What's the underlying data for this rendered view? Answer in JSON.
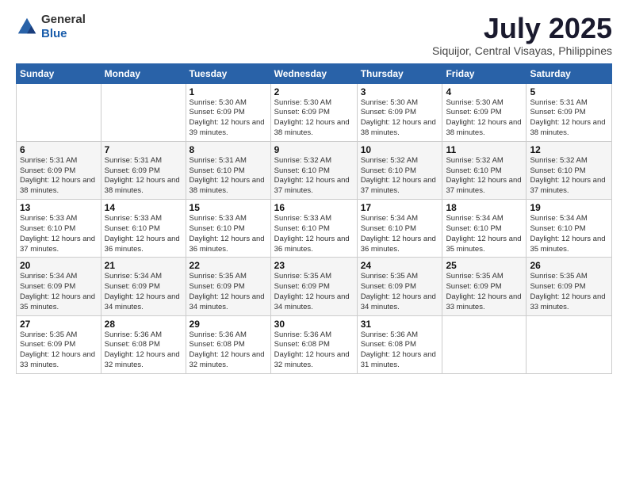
{
  "header": {
    "logo_general": "General",
    "logo_blue": "Blue",
    "month_year": "July 2025",
    "location": "Siquijor, Central Visayas, Philippines"
  },
  "days_of_week": [
    "Sunday",
    "Monday",
    "Tuesday",
    "Wednesday",
    "Thursday",
    "Friday",
    "Saturday"
  ],
  "weeks": [
    [
      {
        "day": "",
        "detail": ""
      },
      {
        "day": "",
        "detail": ""
      },
      {
        "day": "1",
        "detail": "Sunrise: 5:30 AM\nSunset: 6:09 PM\nDaylight: 12 hours and 39 minutes."
      },
      {
        "day": "2",
        "detail": "Sunrise: 5:30 AM\nSunset: 6:09 PM\nDaylight: 12 hours and 38 minutes."
      },
      {
        "day": "3",
        "detail": "Sunrise: 5:30 AM\nSunset: 6:09 PM\nDaylight: 12 hours and 38 minutes."
      },
      {
        "day": "4",
        "detail": "Sunrise: 5:30 AM\nSunset: 6:09 PM\nDaylight: 12 hours and 38 minutes."
      },
      {
        "day": "5",
        "detail": "Sunrise: 5:31 AM\nSunset: 6:09 PM\nDaylight: 12 hours and 38 minutes."
      }
    ],
    [
      {
        "day": "6",
        "detail": "Sunrise: 5:31 AM\nSunset: 6:09 PM\nDaylight: 12 hours and 38 minutes."
      },
      {
        "day": "7",
        "detail": "Sunrise: 5:31 AM\nSunset: 6:09 PM\nDaylight: 12 hours and 38 minutes."
      },
      {
        "day": "8",
        "detail": "Sunrise: 5:31 AM\nSunset: 6:10 PM\nDaylight: 12 hours and 38 minutes."
      },
      {
        "day": "9",
        "detail": "Sunrise: 5:32 AM\nSunset: 6:10 PM\nDaylight: 12 hours and 37 minutes."
      },
      {
        "day": "10",
        "detail": "Sunrise: 5:32 AM\nSunset: 6:10 PM\nDaylight: 12 hours and 37 minutes."
      },
      {
        "day": "11",
        "detail": "Sunrise: 5:32 AM\nSunset: 6:10 PM\nDaylight: 12 hours and 37 minutes."
      },
      {
        "day": "12",
        "detail": "Sunrise: 5:32 AM\nSunset: 6:10 PM\nDaylight: 12 hours and 37 minutes."
      }
    ],
    [
      {
        "day": "13",
        "detail": "Sunrise: 5:33 AM\nSunset: 6:10 PM\nDaylight: 12 hours and 37 minutes."
      },
      {
        "day": "14",
        "detail": "Sunrise: 5:33 AM\nSunset: 6:10 PM\nDaylight: 12 hours and 36 minutes."
      },
      {
        "day": "15",
        "detail": "Sunrise: 5:33 AM\nSunset: 6:10 PM\nDaylight: 12 hours and 36 minutes."
      },
      {
        "day": "16",
        "detail": "Sunrise: 5:33 AM\nSunset: 6:10 PM\nDaylight: 12 hours and 36 minutes."
      },
      {
        "day": "17",
        "detail": "Sunrise: 5:34 AM\nSunset: 6:10 PM\nDaylight: 12 hours and 36 minutes."
      },
      {
        "day": "18",
        "detail": "Sunrise: 5:34 AM\nSunset: 6:10 PM\nDaylight: 12 hours and 35 minutes."
      },
      {
        "day": "19",
        "detail": "Sunrise: 5:34 AM\nSunset: 6:10 PM\nDaylight: 12 hours and 35 minutes."
      }
    ],
    [
      {
        "day": "20",
        "detail": "Sunrise: 5:34 AM\nSunset: 6:09 PM\nDaylight: 12 hours and 35 minutes."
      },
      {
        "day": "21",
        "detail": "Sunrise: 5:34 AM\nSunset: 6:09 PM\nDaylight: 12 hours and 34 minutes."
      },
      {
        "day": "22",
        "detail": "Sunrise: 5:35 AM\nSunset: 6:09 PM\nDaylight: 12 hours and 34 minutes."
      },
      {
        "day": "23",
        "detail": "Sunrise: 5:35 AM\nSunset: 6:09 PM\nDaylight: 12 hours and 34 minutes."
      },
      {
        "day": "24",
        "detail": "Sunrise: 5:35 AM\nSunset: 6:09 PM\nDaylight: 12 hours and 34 minutes."
      },
      {
        "day": "25",
        "detail": "Sunrise: 5:35 AM\nSunset: 6:09 PM\nDaylight: 12 hours and 33 minutes."
      },
      {
        "day": "26",
        "detail": "Sunrise: 5:35 AM\nSunset: 6:09 PM\nDaylight: 12 hours and 33 minutes."
      }
    ],
    [
      {
        "day": "27",
        "detail": "Sunrise: 5:35 AM\nSunset: 6:09 PM\nDaylight: 12 hours and 33 minutes."
      },
      {
        "day": "28",
        "detail": "Sunrise: 5:36 AM\nSunset: 6:08 PM\nDaylight: 12 hours and 32 minutes."
      },
      {
        "day": "29",
        "detail": "Sunrise: 5:36 AM\nSunset: 6:08 PM\nDaylight: 12 hours and 32 minutes."
      },
      {
        "day": "30",
        "detail": "Sunrise: 5:36 AM\nSunset: 6:08 PM\nDaylight: 12 hours and 32 minutes."
      },
      {
        "day": "31",
        "detail": "Sunrise: 5:36 AM\nSunset: 6:08 PM\nDaylight: 12 hours and 31 minutes."
      },
      {
        "day": "",
        "detail": ""
      },
      {
        "day": "",
        "detail": ""
      }
    ]
  ]
}
